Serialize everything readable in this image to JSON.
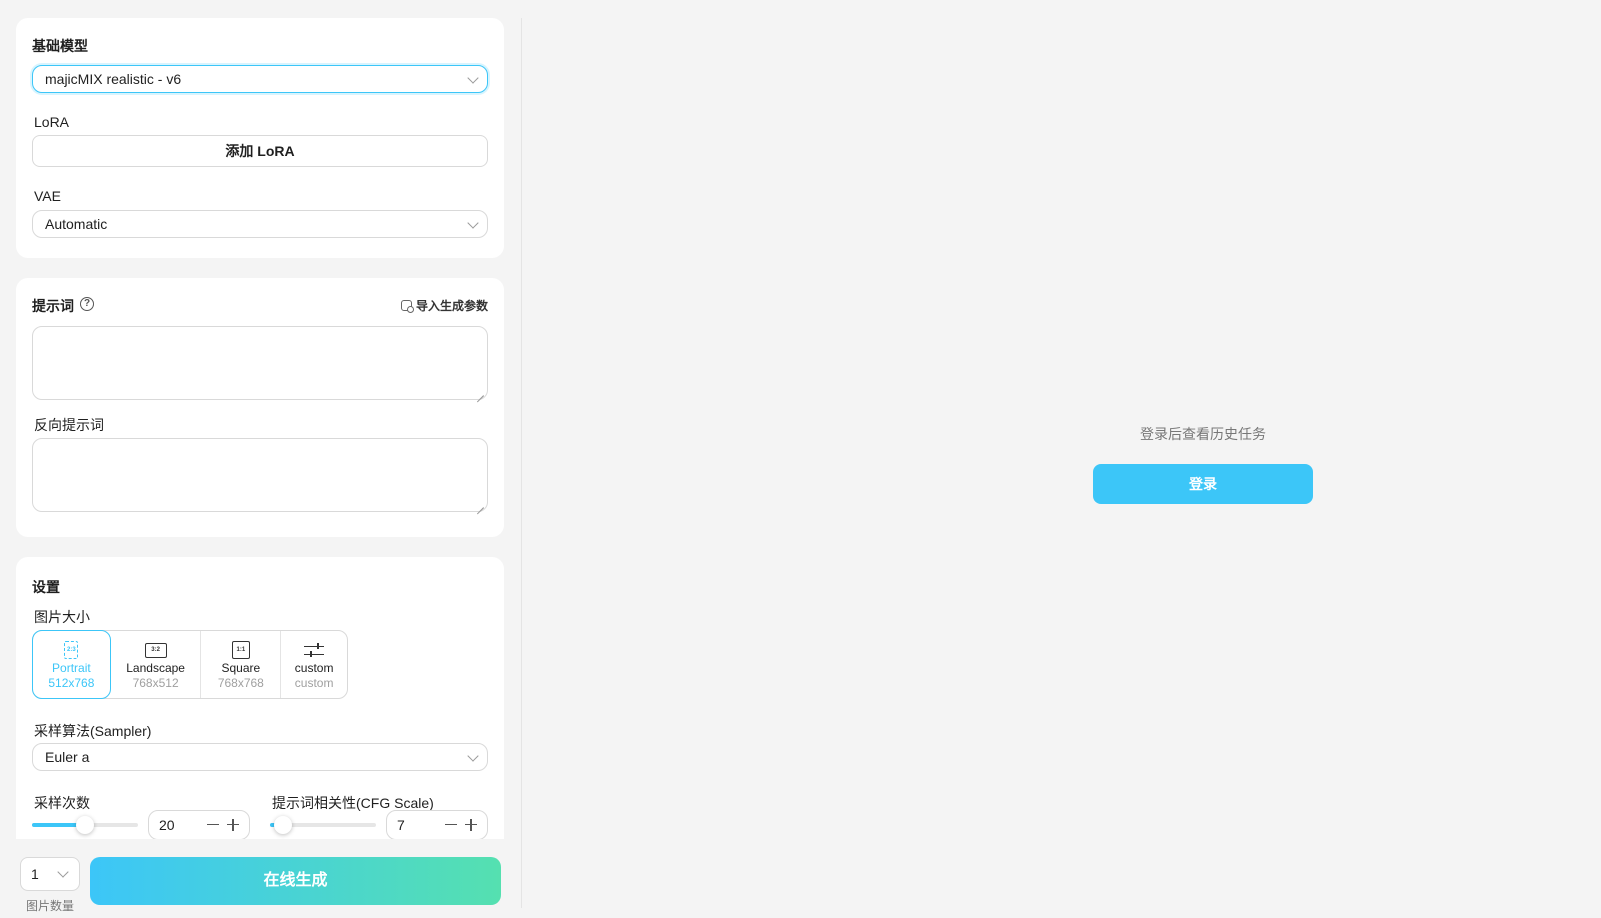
{
  "base_model": {
    "title": "基础模型",
    "selected": "majicMIX realistic - v6"
  },
  "lora": {
    "label": "LoRA",
    "add_button": "添加 LoRA"
  },
  "vae": {
    "label": "VAE",
    "selected": "Automatic"
  },
  "prompt": {
    "title": "提示词",
    "help_glyph": "?",
    "import_label": "导入生成参数",
    "value": "",
    "negative_label": "反向提示词",
    "negative_value": ""
  },
  "settings": {
    "title": "设置",
    "image_size_label": "图片大小",
    "sizes": [
      {
        "ratio": "2:3",
        "name": "Portrait",
        "dims": "512x768",
        "active": true
      },
      {
        "ratio": "3:2",
        "name": "Landscape",
        "dims": "768x512",
        "active": false
      },
      {
        "ratio": "1:1",
        "name": "Square",
        "dims": "768x768",
        "active": false
      },
      {
        "ratio": "",
        "name": "custom",
        "dims": "custom",
        "active": false
      }
    ],
    "sampler_label": "采样算法(Sampler)",
    "sampler_selected": "Euler a",
    "steps_label": "采样次数",
    "steps_value": "20",
    "steps_fraction": 0.5,
    "cfg_label": "提示词相关性(CFG Scale)",
    "cfg_value": "7",
    "cfg_fraction": 0.12
  },
  "bottom": {
    "count_value": "1",
    "count_label": "图片数量",
    "generate_button": "在线生成"
  },
  "history": {
    "message": "登录后查看历史任务",
    "login_button": "登录"
  },
  "colors": {
    "accent": "#3cc6f8",
    "gradient_end": "#55e0b0",
    "background": "#f4f4f4"
  }
}
